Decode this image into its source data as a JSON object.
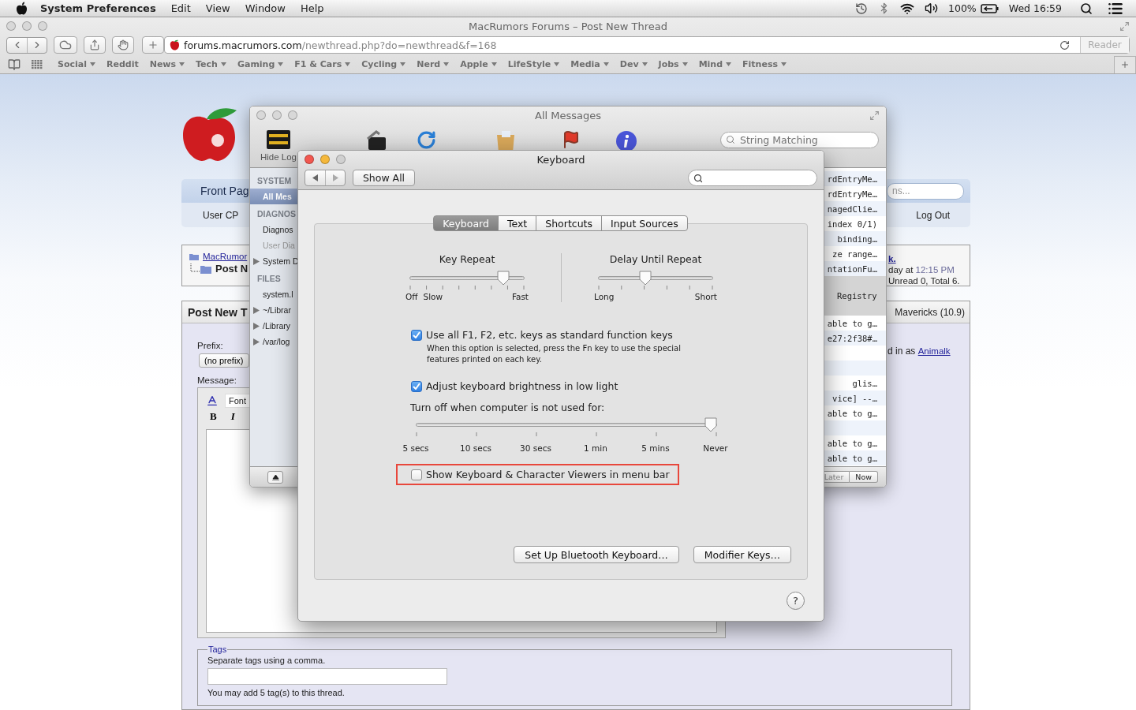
{
  "menubar": {
    "app": "System Preferences",
    "menus": [
      "Edit",
      "View",
      "Window",
      "Help"
    ],
    "battery": "100%",
    "clock": "Wed 16:59"
  },
  "browser": {
    "title": "MacRumors Forums – Post New Thread",
    "url_host": "forums.macrumors.com",
    "url_path": "/newthread.php?do=newthread&f=168",
    "reader": "Reader",
    "bookmarks": [
      {
        "label": "Social",
        "menu": true
      },
      {
        "label": "Reddit",
        "menu": false
      },
      {
        "label": "News",
        "menu": true
      },
      {
        "label": "Tech",
        "menu": true
      },
      {
        "label": "Gaming",
        "menu": true
      },
      {
        "label": "F1 & Cars",
        "menu": true
      },
      {
        "label": "Cycling",
        "menu": true
      },
      {
        "label": "Nerd",
        "menu": true
      },
      {
        "label": "Apple",
        "menu": true
      },
      {
        "label": "LifeStyle",
        "menu": true
      },
      {
        "label": "Media",
        "menu": true
      },
      {
        "label": "Dev",
        "menu": true
      },
      {
        "label": "Jobs",
        "menu": true
      },
      {
        "label": "Mind",
        "menu": true
      },
      {
        "label": "Fitness",
        "menu": true
      }
    ]
  },
  "forum": {
    "nav": {
      "tab": "Front Pag",
      "search_placeholder": "ns...",
      "left_link": "User CP",
      "right_link": "Log Out"
    },
    "breadcrumb": {
      "link": "MacRumor",
      "current": "Post N"
    },
    "info": {
      "user": "k.",
      "day": "day at",
      "time": "12:15 PM",
      "counts": "Unread 0, Total 6."
    },
    "post": {
      "title": "Post New T",
      "forum_name": "Mavericks (10.9)",
      "prefix_label": "Prefix:",
      "prefix_value": "(no prefix)",
      "message_label": "Message:",
      "font_field": "Font",
      "format_buttons": [
        "B",
        "I"
      ],
      "login_prefix": "d in as",
      "login_user": "Animalk"
    },
    "tags": {
      "legend": "Tags",
      "hint": "Separate tags using a comma.",
      "note": "You may add 5 tag(s) to this thread."
    }
  },
  "console": {
    "title": "All Messages",
    "hide_log": "Hide Log",
    "search_placeholder": "String Matching",
    "sidebar": [
      {
        "header": "SYSTEM",
        "items": [
          {
            "label": "All Mes",
            "selected": true,
            "dimmed": false,
            "expandable": false
          }
        ]
      },
      {
        "header": "DIAGNOS",
        "items": [
          {
            "label": "Diagnos",
            "selected": false,
            "dimmed": false,
            "expandable": false
          },
          {
            "label": "User Dia",
            "selected": false,
            "dimmed": true,
            "expandable": false
          },
          {
            "label": "System D",
            "selected": false,
            "dimmed": false,
            "expandable": true
          }
        ]
      },
      {
        "header": "FILES",
        "items": [
          {
            "label": "system.l",
            "selected": false,
            "dimmed": false,
            "expandable": false
          },
          {
            "label": "~/Librar",
            "selected": false,
            "dimmed": false,
            "expandable": true
          },
          {
            "label": "/Library",
            "selected": false,
            "dimmed": false,
            "expandable": true
          },
          {
            "label": "/var/log",
            "selected": false,
            "dimmed": false,
            "expandable": true
          }
        ]
      }
    ],
    "rows": [
      {
        "kind": "entry",
        "text": "rdEntryMe…"
      },
      {
        "kind": "entry",
        "text": "rdEntryMe…"
      },
      {
        "kind": "entry",
        "text": "nagedClie…"
      },
      {
        "kind": "entry",
        "text": "index 0/1)"
      },
      {
        "kind": "entry",
        "text": "binding…"
      },
      {
        "kind": "entry",
        "text": "ze range…"
      },
      {
        "kind": "entry",
        "text": "ntationFu…"
      },
      {
        "kind": "group",
        "text": "Registry"
      },
      {
        "kind": "entry",
        "text": "able to g…"
      },
      {
        "kind": "entry",
        "text": "e27:2f38#…"
      },
      {
        "kind": "gap"
      },
      {
        "kind": "gap"
      },
      {
        "kind": "entry",
        "text": "glis…"
      },
      {
        "kind": "entry",
        "text": "vice] --…"
      },
      {
        "kind": "entry",
        "text": "able to g…"
      },
      {
        "kind": "gap"
      },
      {
        "kind": "entry",
        "text": "able to g…"
      },
      {
        "kind": "entry",
        "text": "able to g…"
      }
    ],
    "update_buttons": [
      "Later",
      "Now"
    ]
  },
  "keyboard": {
    "title": "Keyboard",
    "show_all": "Show All",
    "tabs": [
      {
        "label": "Keyboard",
        "selected": true
      },
      {
        "label": "Text",
        "selected": false
      },
      {
        "label": "Shortcuts",
        "selected": false
      },
      {
        "label": "Input Sources",
        "selected": false
      }
    ],
    "sections": [
      {
        "kind": "sliders",
        "columns": [
          {
            "title": "Key Repeat",
            "level": 0.85,
            "min_labels": [
              "Off",
              "Slow"
            ],
            "max_label": "Fast"
          },
          {
            "title": "Delay Until Repeat",
            "level": 0.4,
            "min_labels": [
              "Long"
            ],
            "max_label": "Short"
          }
        ]
      },
      {
        "kind": "checkbox",
        "label": "Use all F1, F2, etc. keys as standard function keys",
        "checked": true,
        "highlighted": false,
        "note": "When this option is selected, press the Fn key to use the special features printed on each key."
      },
      {
        "kind": "checkbox",
        "label": "Adjust keyboard brightness in low light",
        "checked": true,
        "highlighted": false
      },
      {
        "kind": "label",
        "text": "Turn off when computer is not used for:"
      },
      {
        "kind": "scale",
        "level": 1,
        "marks": [
          "5 secs",
          "10 secs",
          "30 secs",
          "1 min",
          "5 mins",
          "Never"
        ]
      },
      {
        "kind": "checkbox",
        "label": "Show Keyboard & Character Viewers in menu bar",
        "checked": false,
        "highlighted": true
      }
    ],
    "buttons": [
      "Set Up Bluetooth Keyboard…",
      "Modifier Keys…"
    ],
    "help": "?"
  }
}
